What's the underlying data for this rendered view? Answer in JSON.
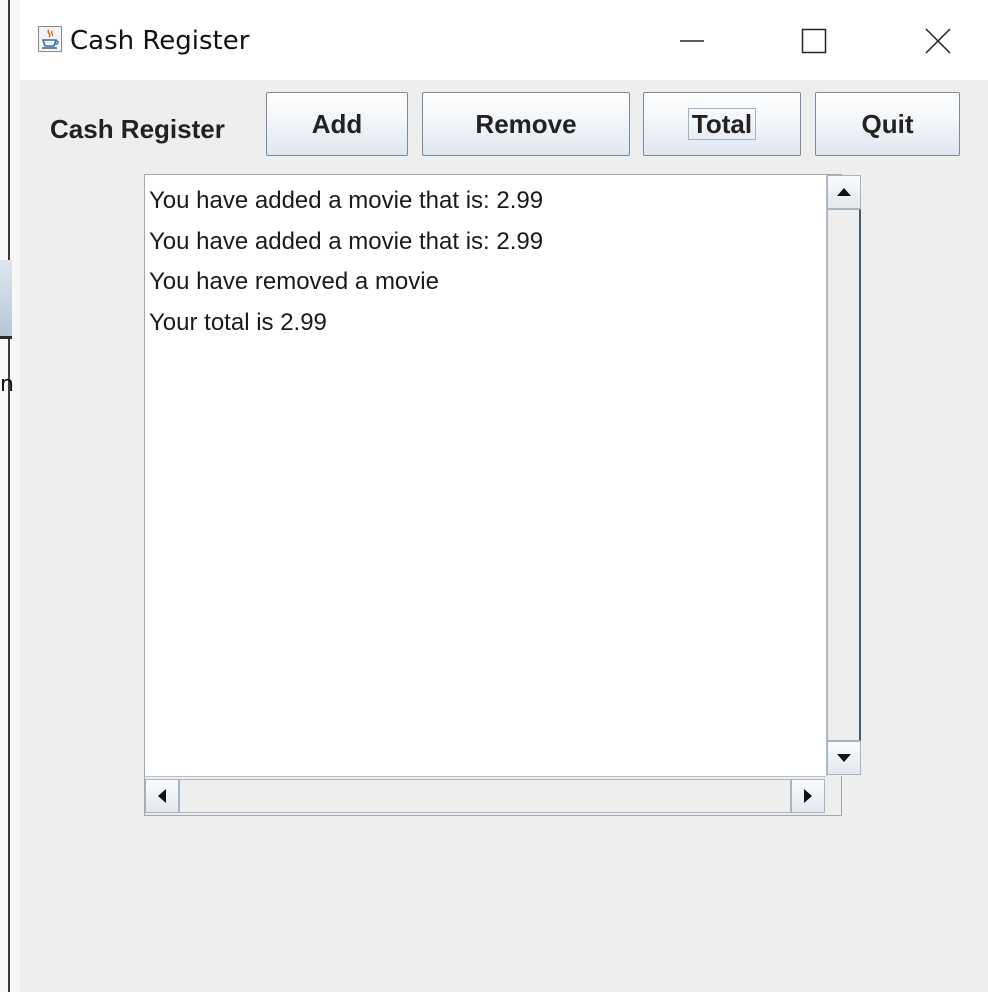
{
  "window": {
    "title": "Cash Register",
    "icon": "java-cup-icon"
  },
  "background": {
    "fragment_text": "n"
  },
  "title_controls": {
    "minimize_icon": "minimize-icon",
    "maximize_icon": "maximize-icon",
    "close_icon": "close-icon"
  },
  "toolbar": {
    "label": "Cash Register",
    "add_label": "Add",
    "remove_label": "Remove",
    "total_label": "Total",
    "quit_label": "Quit"
  },
  "output": {
    "lines": [
      "You have added a movie that is: 2.99",
      "You have added a movie that is: 2.99",
      "You have removed a movie",
      "Your total is 2.99"
    ]
  },
  "colors": {
    "window_bg": "#eeeeee",
    "button_border": "#7a8a99",
    "text": "#1a1a1a"
  }
}
